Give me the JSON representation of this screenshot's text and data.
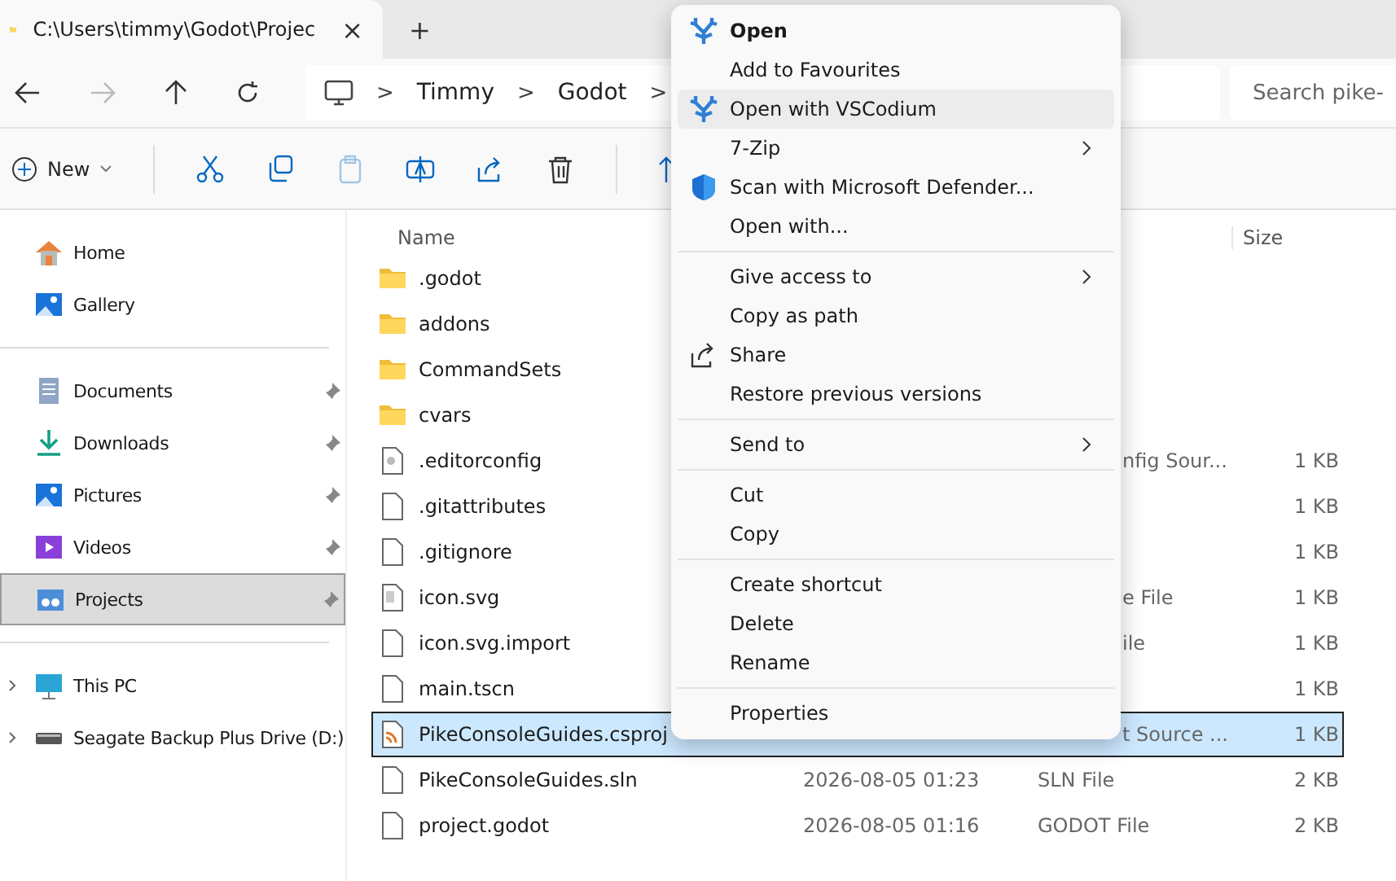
{
  "tab": {
    "title": "C:\\Users\\timmy\\Godot\\Projec",
    "close": "×",
    "new_tab": "+"
  },
  "address": {
    "crumbs": [
      "Timmy",
      "Godot"
    ],
    "separator": ">",
    "search_placeholder": "Search pike-"
  },
  "toolbar": {
    "new_label": "New",
    "items": [
      {
        "kind": "cut",
        "disabled": false
      },
      {
        "kind": "copy",
        "disabled": false
      },
      {
        "kind": "paste",
        "disabled": true
      },
      {
        "kind": "rename",
        "disabled": false
      },
      {
        "kind": "share",
        "disabled": false
      },
      {
        "kind": "delete",
        "disabled": false
      },
      {
        "kind": "sort",
        "disabled": false
      }
    ]
  },
  "sidebar": {
    "groups": [
      [
        {
          "label": "Home",
          "kind": "home",
          "pinned": false,
          "selected": false
        },
        {
          "label": "Gallery",
          "kind": "gallery",
          "pinned": false,
          "selected": false
        }
      ],
      [
        {
          "label": "Documents",
          "kind": "documents",
          "pinned": true,
          "selected": false
        },
        {
          "label": "Downloads",
          "kind": "downloads",
          "pinned": true,
          "selected": false
        },
        {
          "label": "Pictures",
          "kind": "pictures",
          "pinned": true,
          "selected": false
        },
        {
          "label": "Videos",
          "kind": "videos",
          "pinned": true,
          "selected": false
        },
        {
          "label": "Projects",
          "kind": "projects",
          "pinned": true,
          "selected": true
        }
      ],
      [
        {
          "label": "This PC",
          "kind": "pc",
          "pinned": false,
          "selected": false,
          "expanded": false
        },
        {
          "label": "Seagate Backup Plus Drive (D:)",
          "kind": "drive",
          "pinned": false,
          "selected": false,
          "expanded": false
        }
      ]
    ]
  },
  "table": {
    "columns": [
      "Name",
      "Size"
    ],
    "rows": [
      {
        "name": ".godot",
        "kind": "folder",
        "selected": false
      },
      {
        "name": "addons",
        "kind": "folder",
        "selected": false
      },
      {
        "name": "CommandSets",
        "kind": "folder",
        "selected": false
      },
      {
        "name": "cvars",
        "kind": "folder",
        "selected": false
      },
      {
        "name": ".editorconfig",
        "kind": "config",
        "type": "nfig Sour...",
        "clipped": true,
        "size": "1 KB",
        "selected": false
      },
      {
        "name": ".gitattributes",
        "kind": "file",
        "size": "1 KB",
        "selected": false
      },
      {
        "name": ".gitignore",
        "kind": "file",
        "size": "1 KB",
        "selected": false
      },
      {
        "name": "icon.svg",
        "kind": "image",
        "type": "e File",
        "clipped": true,
        "size": "1 KB",
        "selected": false
      },
      {
        "name": "icon.svg.import",
        "kind": "file",
        "type": "ile",
        "clipped": true,
        "size": "1 KB",
        "selected": false
      },
      {
        "name": "main.tscn",
        "kind": "file",
        "size": "1 KB",
        "selected": false
      },
      {
        "name": "PikeConsoleGuides.csproj",
        "kind": "project",
        "type": "t Source ...",
        "clipped": true,
        "size": "1 KB",
        "selected": true
      },
      {
        "name": "PikeConsoleGuides.sln",
        "kind": "file",
        "date": "2026-08-05 01:23",
        "type": "SLN File",
        "size": "2 KB",
        "selected": false
      },
      {
        "name": "project.godot",
        "kind": "file",
        "date": "2026-08-05 01:16",
        "type": "GODOT File",
        "size": "2 KB",
        "selected": false
      }
    ]
  },
  "context_menu": {
    "items": [
      {
        "kind": "app",
        "label": "Open",
        "default": true,
        "submenu": false,
        "selected": false
      },
      {
        "kind": "item",
        "label": "Add to Favourites",
        "submenu": false,
        "selected": false
      },
      {
        "kind": "app",
        "label": "Open with VSCodium",
        "submenu": false,
        "selected": true
      },
      {
        "kind": "item",
        "label": "7-Zip",
        "submenu": true,
        "selected": false
      },
      {
        "kind": "scan",
        "label": "Scan with Microsoft Defender...",
        "submenu": false,
        "selected": false
      },
      {
        "kind": "item",
        "label": "Open with...",
        "submenu": false,
        "selected": false
      },
      {
        "kind": "separator"
      },
      {
        "kind": "item",
        "label": "Give access to",
        "submenu": true,
        "selected": false
      },
      {
        "kind": "item",
        "label": "Copy as path",
        "submenu": false,
        "selected": false
      },
      {
        "kind": "share",
        "label": "Share",
        "submenu": false,
        "selected": false
      },
      {
        "kind": "item",
        "label": "Restore previous versions",
        "submenu": false,
        "selected": false
      },
      {
        "kind": "separator"
      },
      {
        "kind": "item",
        "label": "Send to",
        "submenu": true,
        "selected": false
      },
      {
        "kind": "separator"
      },
      {
        "kind": "item",
        "label": "Cut",
        "submenu": false,
        "selected": false
      },
      {
        "kind": "item",
        "label": "Copy",
        "submenu": false,
        "selected": false
      },
      {
        "kind": "separator"
      },
      {
        "kind": "item",
        "label": "Create shortcut",
        "submenu": false,
        "selected": false
      },
      {
        "kind": "item",
        "label": "Delete",
        "submenu": false,
        "selected": false
      },
      {
        "kind": "item",
        "label": "Rename",
        "submenu": false,
        "selected": false
      },
      {
        "kind": "separator"
      },
      {
        "kind": "item",
        "label": "Properties",
        "submenu": false,
        "selected": false
      }
    ]
  }
}
